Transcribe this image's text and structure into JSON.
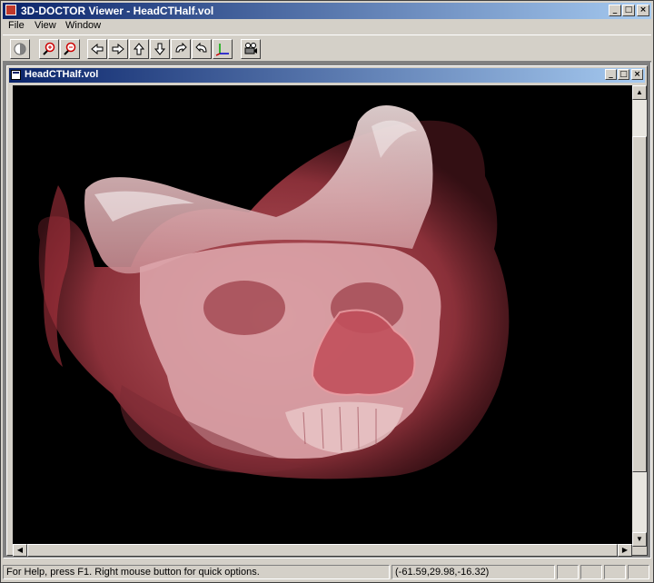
{
  "window": {
    "title": "3D-DOCTOR Viewer - HeadCTHalf.vol",
    "minimize": "_",
    "maximize": "□",
    "close": "×"
  },
  "menu": {
    "items": [
      "File",
      "View",
      "Window"
    ]
  },
  "toolbar": {
    "buttons": [
      {
        "name": "contrast-icon"
      },
      {
        "name": "zoom-in-icon"
      },
      {
        "name": "zoom-out-icon"
      },
      {
        "name": "arrow-left-icon"
      },
      {
        "name": "arrow-right-icon"
      },
      {
        "name": "arrow-up-icon"
      },
      {
        "name": "arrow-down-icon"
      },
      {
        "name": "rotate-left-icon"
      },
      {
        "name": "rotate-right-icon"
      },
      {
        "name": "axes-icon"
      },
      {
        "name": "camera-icon"
      }
    ]
  },
  "document": {
    "title": "HeadCTHalf.vol",
    "image": "3D volume rendering of a head CT scan (skull and soft tissue in translucent red)"
  },
  "statusbar": {
    "help": "For Help, press F1. Right mouse button for quick options.",
    "coords": "(-61.59,29.98,-16.32)"
  },
  "colors": {
    "titlebar_start": "#0a246a",
    "titlebar_end": "#a6caf0",
    "face": "#d4d0c8",
    "render_tissue": "#c04a55",
    "render_bone": "#e6c8c8"
  }
}
